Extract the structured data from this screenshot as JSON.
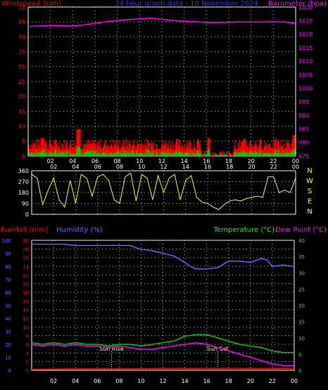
{
  "chart_data": [
    {
      "type": "area",
      "panel": "wind-barometer",
      "title": "24 hour graph data - 10 November 2024",
      "left_axis_label": "Windspeed (kph)",
      "right_axis_label": "Barometer (hpa)",
      "left_ylim": [
        0,
        50
      ],
      "left_ticks": [
        0,
        5,
        10,
        15,
        20,
        25,
        30,
        35,
        40,
        45,
        50
      ],
      "right_ylim": [
        975,
        1030
      ],
      "right_ticks": [
        975,
        980,
        985,
        990,
        995,
        1000,
        1005,
        1010,
        1015,
        1020,
        1025,
        1030
      ],
      "x_ticks": [
        "02",
        "04",
        "06",
        "08",
        "10",
        "12",
        "14",
        "16",
        "18",
        "20",
        "22",
        "00"
      ],
      "grid": true,
      "colors": {
        "gust": "#ff0000",
        "average": "#00cc00",
        "barometer": "#ff00ff",
        "left_axis": "#ff0000",
        "right_axis": "#ff00ff",
        "title": "#3333ff"
      },
      "series": [
        {
          "name": "Barometer",
          "x": [
            0,
            1,
            2,
            3,
            4,
            5,
            6,
            7,
            8,
            9,
            10,
            11,
            12,
            13,
            14,
            15,
            16,
            17,
            18,
            19,
            20,
            21,
            22,
            23,
            24
          ],
          "values": [
            1022.8,
            1023.0,
            1023.2,
            1023.2,
            1023.0,
            1023.4,
            1024.0,
            1024.6,
            1025.0,
            1025.4,
            1025.6,
            1025.9,
            1025.5,
            1025.0,
            1024.8,
            1024.6,
            1024.3,
            1024.3,
            1024.4,
            1024.5,
            1024.5,
            1024.5,
            1024.6,
            1024.5,
            1024.0
          ]
        }
      ]
    },
    {
      "type": "line",
      "panel": "wind-direction",
      "ylim": [
        0,
        360
      ],
      "left_ticks": [
        0,
        90,
        180,
        270,
        360
      ],
      "right_labels": [
        "N",
        "W",
        "S",
        "E",
        "N"
      ],
      "x_ticks": [
        "02",
        "04",
        "06",
        "08",
        "10",
        "12",
        "14",
        "16",
        "18",
        "20",
        "22",
        "00"
      ],
      "grid": true,
      "colors": {
        "line": "#ffff00",
        "right_labels": "#ffff00"
      },
      "series": [
        {
          "name": "Wind direction",
          "x": [
            0,
            0.5,
            1,
            1.5,
            2,
            2.5,
            3,
            3.5,
            4,
            4.5,
            5,
            5.5,
            6,
            6.5,
            7,
            7.5,
            8,
            8.5,
            9,
            9.5,
            10,
            10.5,
            11,
            11.5,
            12,
            12.5,
            13,
            13.5,
            14,
            14.5,
            15,
            15.5,
            16,
            16.5,
            17,
            17.5,
            18,
            18.5,
            19,
            19.5,
            20,
            20.5,
            21,
            21.5,
            22,
            22.5,
            23,
            23.5,
            24
          ],
          "values": [
            330,
            300,
            80,
            200,
            300,
            120,
            60,
            280,
            90,
            330,
            300,
            150,
            310,
            330,
            280,
            120,
            90,
            310,
            340,
            110,
            330,
            300,
            120,
            320,
            180,
            300,
            330,
            120,
            280,
            320,
            140,
            100,
            90,
            60,
            40,
            80,
            110,
            120,
            110,
            130,
            140,
            150,
            140,
            310,
            310,
            180,
            200,
            180,
            300
          ]
        }
      ]
    },
    {
      "type": "line",
      "panel": "rain-humidity-temperature",
      "left_axis_label": "Rainfall (mm)",
      "humidity_label": "Humidity (%)",
      "temperature_label": "Temperature (°C)",
      "dewpoint_label": "Dew Point (°C)",
      "rain_ticks": [
        0,
        2,
        4,
        6,
        8,
        10,
        12,
        14,
        16,
        18,
        20,
        22,
        24,
        26,
        28,
        30
      ],
      "rain_ylim": [
        0,
        30
      ],
      "humidity_ticks": [
        0,
        10,
        20,
        30,
        40,
        50,
        60,
        70,
        80,
        90,
        100
      ],
      "humidity_ylim": [
        0,
        100
      ],
      "temperature_ticks": [
        0,
        5,
        10,
        15,
        20,
        25,
        30,
        35,
        40
      ],
      "temperature_ylim": [
        0,
        40
      ],
      "x_ticks": [
        "02",
        "04",
        "06",
        "08",
        "10",
        "12",
        "14",
        "16",
        "18",
        "20",
        "22",
        "00"
      ],
      "annotations": [
        "Sun Rise",
        "Sun Set"
      ],
      "grid": true,
      "colors": {
        "rain": "#ff0000",
        "humidity": "#6666ff",
        "temperature": "#00cc00",
        "dewpoint": "#ff00ff",
        "temp_axis": "#00ff00"
      },
      "series": [
        {
          "name": "Humidity",
          "x": [
            0,
            1,
            2,
            3,
            4,
            5,
            6,
            7,
            8,
            9,
            10,
            11,
            12,
            13,
            14,
            14.5,
            15,
            16,
            17,
            18,
            19,
            20,
            21,
            21.5,
            22,
            23,
            24
          ],
          "values": [
            97,
            97,
            97,
            97,
            96,
            96,
            96,
            96,
            96,
            96,
            93,
            92,
            90,
            88,
            83,
            80,
            78,
            78,
            79,
            84,
            84,
            83,
            86,
            85,
            80,
            81,
            80
          ]
        },
        {
          "name": "Temperature",
          "x": [
            0,
            1,
            2,
            3,
            4,
            5,
            6,
            7,
            8,
            9,
            10,
            11,
            12,
            13,
            14,
            15,
            16,
            17,
            18,
            19,
            20,
            21,
            22,
            23,
            24
          ],
          "values": [
            8.5,
            8,
            8.5,
            8,
            8.5,
            8,
            8,
            7.5,
            8,
            8,
            7.5,
            8,
            8.5,
            9,
            10.5,
            11,
            11,
            10,
            9,
            8,
            7.5,
            7,
            6,
            5.5,
            5.5
          ]
        },
        {
          "name": "Dew Point",
          "x": [
            0,
            1,
            2,
            3,
            4,
            5,
            6,
            7,
            8,
            9,
            10,
            11,
            12,
            13,
            14,
            15,
            16,
            17,
            18,
            19,
            20,
            21,
            22,
            23,
            24
          ],
          "values": [
            8,
            7.5,
            8,
            7.5,
            8,
            7.5,
            7.5,
            7,
            7.5,
            7,
            6.5,
            6.5,
            7,
            7.5,
            8,
            8.5,
            8,
            7,
            6,
            5,
            4,
            3,
            2,
            1.5,
            1.5
          ]
        },
        {
          "name": "Rainfall",
          "x": [
            0,
            4,
            8,
            12,
            16,
            20,
            24
          ],
          "values": [
            0.2,
            0.3,
            0.3,
            0.4,
            0.4,
            0.4,
            0.4
          ]
        }
      ]
    }
  ]
}
